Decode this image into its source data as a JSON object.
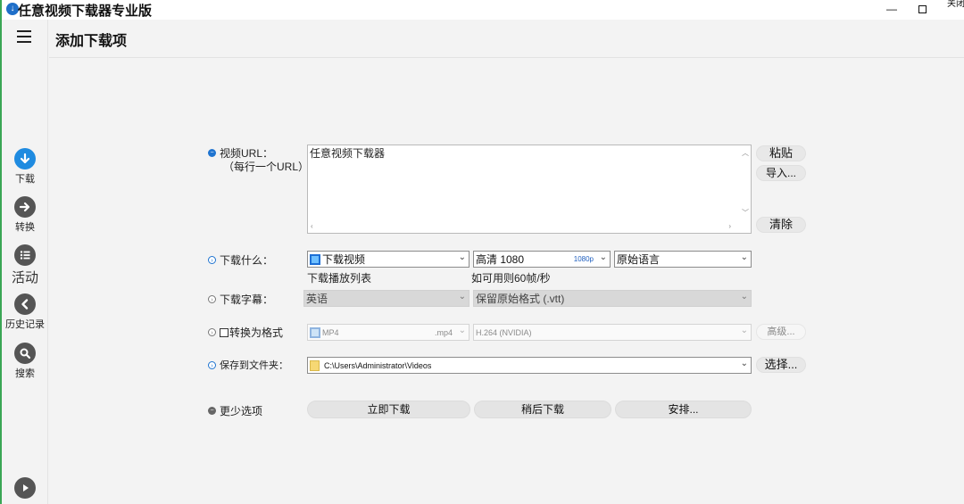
{
  "window": {
    "title": "任意视频下载器专业版",
    "close_label": "关闭"
  },
  "header": {
    "title": "添加下载项"
  },
  "sidebar": {
    "items": [
      {
        "label": "下载",
        "icon": "download-icon",
        "color": "#1f8be0"
      },
      {
        "label": "转换",
        "icon": "convert-icon",
        "color": "#555555"
      },
      {
        "label": "活动",
        "icon": "activity-icon",
        "color": "#555555"
      },
      {
        "label": "历史记录",
        "icon": "history-icon",
        "color": "#555555"
      },
      {
        "label": "搜索",
        "icon": "search-icon",
        "color": "#555555"
      }
    ]
  },
  "form": {
    "url": {
      "label": "视频URL：",
      "sublabel": "（每行一个URL）",
      "value": "任意视频下载器",
      "paste_label": "粘贴",
      "import_label": "导入...",
      "clear_label": "清除"
    },
    "what": {
      "label": "下载什么：",
      "type_value": "下载视频",
      "quality_value": "高清 1080",
      "quality_tag": "1080p",
      "language_value": "原始语言",
      "playlist_caption": "下载播放列表",
      "fps_caption": "如可用则60帧/秒"
    },
    "subtitle": {
      "label": "下载字幕：",
      "language_value": "英语",
      "format_value": "保留原始格式 (.vtt)"
    },
    "convert": {
      "label": "转换为格式",
      "format_value": "MP4",
      "format_ext": ".mp4",
      "codec_value": "H.264 (NVIDIA)",
      "advanced_label": "高级..."
    },
    "save": {
      "label": "保存到文件夹：",
      "path_value": "C:\\Users\\Administrator\\Videos",
      "choose_label": "选择..."
    },
    "more": {
      "label": "更少选项",
      "download_now_label": "立即下载",
      "download_later_label": "稍后下载",
      "schedule_label": "安排..."
    }
  },
  "colors": {
    "accent": "#1f8be0",
    "edge": "#3aa655",
    "background": "#f3f3f3"
  }
}
